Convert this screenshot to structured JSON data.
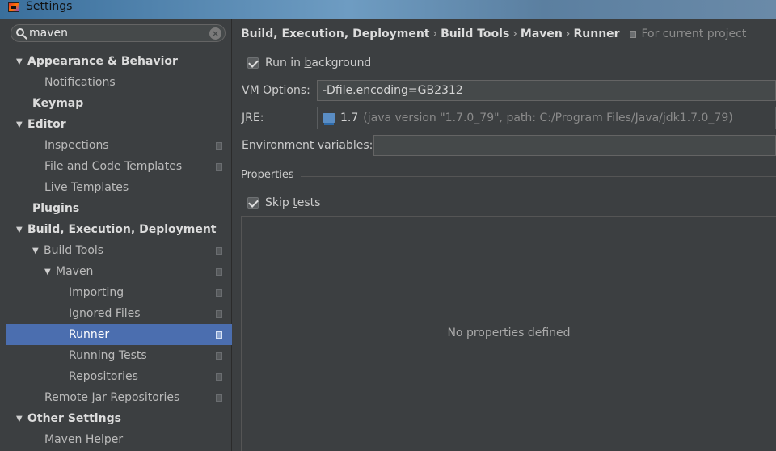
{
  "window": {
    "title": "Settings"
  },
  "search": {
    "value": "maven"
  },
  "sidebar": {
    "items": [
      {
        "label": "Appearance & Behavior"
      },
      {
        "label": "Notifications"
      },
      {
        "label": "Keymap"
      },
      {
        "label": "Editor"
      },
      {
        "label": "Inspections"
      },
      {
        "label": "File and Code Templates"
      },
      {
        "label": "Live Templates"
      },
      {
        "label": "Plugins"
      },
      {
        "label": "Build, Execution, Deployment"
      },
      {
        "label": "Build Tools"
      },
      {
        "label": "Maven"
      },
      {
        "label": "Importing"
      },
      {
        "label": "Ignored Files"
      },
      {
        "label": "Runner"
      },
      {
        "label": "Running Tests"
      },
      {
        "label": "Repositories"
      },
      {
        "label": "Remote Jar Repositories"
      },
      {
        "label": "Other Settings"
      },
      {
        "label": "Maven Helper"
      }
    ]
  },
  "breadcrumb": {
    "parts": [
      "Build, Execution, Deployment",
      "Build Tools",
      "Maven",
      "Runner"
    ],
    "separator": "›",
    "scope": "For current project"
  },
  "runner": {
    "run_in_background": {
      "label_pre": "Run in ",
      "label_mnemonic": "b",
      "label_post": "ackground",
      "checked": true
    },
    "vm_options": {
      "label_mnemonic": "V",
      "label_rest": "M Options:",
      "value": "-Dfile.encoding=GB2312"
    },
    "jre": {
      "label_mnemonic": "J",
      "label_rest": "RE:",
      "version": "1.7",
      "detail": "(java version \"1.7.0_79\", path: C:/Program Files/Java/jdk1.7.0_79)"
    },
    "env_vars": {
      "label_mnemonic": "E",
      "label_rest": "nvironment variables:",
      "value": ""
    },
    "properties": {
      "header": "Properties",
      "skip_tests": {
        "label_pre": "Skip ",
        "label_mnemonic": "t",
        "label_post": "ests",
        "checked": true
      },
      "empty_text": "No properties defined"
    }
  },
  "colors": {
    "background": "#3c3f41",
    "selection": "#4b6eaf",
    "text": "#bbbbbb"
  }
}
